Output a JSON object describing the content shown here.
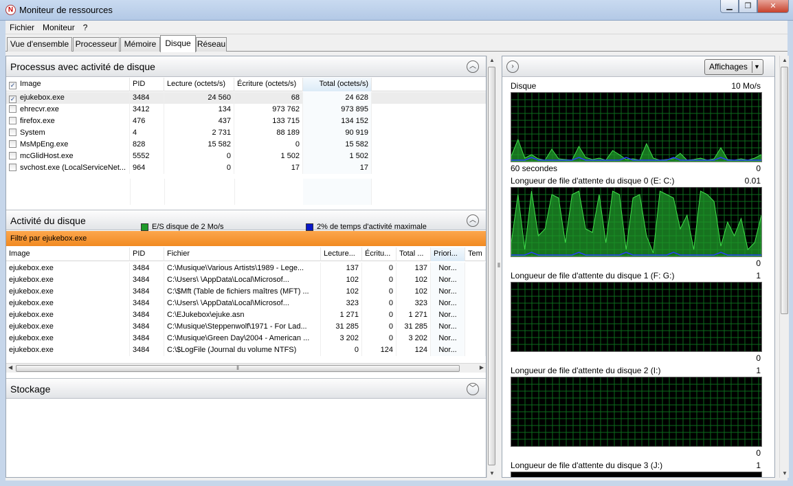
{
  "window": {
    "title": "Moniteur de ressources"
  },
  "menu": [
    "Fichier",
    "Moniteur",
    "?"
  ],
  "tabs": [
    "Vue d'ensemble",
    "Processeur",
    "Mémoire",
    "Disque",
    "Réseau"
  ],
  "active_tab": "Disque",
  "processes_section": {
    "title": "Processus avec activité de disque",
    "columns": [
      "Image",
      "PID",
      "Lecture (octets/s)",
      "Écriture (octets/s)",
      "Total (octets/s)"
    ],
    "rows": [
      {
        "image": "ejukebox.exe",
        "pid": "3484",
        "read": "24 560",
        "write": "68",
        "total": "24 628",
        "checked": true
      },
      {
        "image": "ehrecvr.exe",
        "pid": "3412",
        "read": "134",
        "write": "973 762",
        "total": "973 895",
        "checked": false
      },
      {
        "image": "firefox.exe",
        "pid": "476",
        "read": "437",
        "write": "133 715",
        "total": "134 152",
        "checked": false
      },
      {
        "image": "System",
        "pid": "4",
        "read": "2 731",
        "write": "88 189",
        "total": "90 919",
        "checked": false
      },
      {
        "image": "MsMpEng.exe",
        "pid": "828",
        "read": "15 582",
        "write": "0",
        "total": "15 582",
        "checked": false
      },
      {
        "image": "mcGlidHost.exe",
        "pid": "5552",
        "read": "0",
        "write": "1 502",
        "total": "1 502",
        "checked": false
      },
      {
        "image": "svchost.exe (LocalServiceNet...",
        "pid": "964",
        "read": "0",
        "write": "17",
        "total": "17",
        "checked": false
      }
    ]
  },
  "activity_section": {
    "title": "Activité du disque",
    "legend_io": "E/S disque de 2 Mo/s",
    "legend_io_color": "#1f9a2a",
    "legend_busy": "2% de temps d'activité maximale",
    "legend_busy_color": "#0a18c8",
    "filter": "Filtré par ejukebox.exe",
    "columns": [
      "Image",
      "PID",
      "Fichier",
      "Lecture...",
      "Écritu...",
      "Total ...",
      "Priori...",
      "Tem"
    ],
    "rows": [
      {
        "image": "ejukebox.exe",
        "pid": "3484",
        "file": "C:\\Musique\\Various Artists\\1989 - Lege...",
        "read": "137",
        "write": "0",
        "total": "137",
        "prio": "Nor..."
      },
      {
        "image": "ejukebox.exe",
        "pid": "3484",
        "file": "C:\\Users\\          \\AppData\\Local\\Microsof...",
        "read": "102",
        "write": "0",
        "total": "102",
        "prio": "Nor..."
      },
      {
        "image": "ejukebox.exe",
        "pid": "3484",
        "file": "C:\\$Mft (Table de fichiers maîtres (MFT) ...",
        "read": "102",
        "write": "0",
        "total": "102",
        "prio": "Nor..."
      },
      {
        "image": "ejukebox.exe",
        "pid": "3484",
        "file": "C:\\Users\\          \\AppData\\Local\\Microsof...",
        "read": "323",
        "write": "0",
        "total": "323",
        "prio": "Nor..."
      },
      {
        "image": "ejukebox.exe",
        "pid": "3484",
        "file": "C:\\EJukebox\\ejuke.asn",
        "read": "1 271",
        "write": "0",
        "total": "1 271",
        "prio": "Nor..."
      },
      {
        "image": "ejukebox.exe",
        "pid": "3484",
        "file": "C:\\Musique\\Steppenwolf\\1971 - For Lad...",
        "read": "31 285",
        "write": "0",
        "total": "31 285",
        "prio": "Nor..."
      },
      {
        "image": "ejukebox.exe",
        "pid": "3484",
        "file": "C:\\Musique\\Green Day\\2004 - American ...",
        "read": "3 202",
        "write": "0",
        "total": "3 202",
        "prio": "Nor..."
      },
      {
        "image": "ejukebox.exe",
        "pid": "3484",
        "file": "C:\\$LogFile (Journal du volume NTFS)",
        "read": "0",
        "write": "124",
        "total": "124",
        "prio": "Nor..."
      }
    ]
  },
  "storage_section": {
    "title": "Stockage"
  },
  "right_panel": {
    "views_button": "Affichages",
    "graphs": [
      {
        "label": "Disque",
        "max": "10 Mo/s",
        "under_left": "60 secondes",
        "min": "0"
      },
      {
        "label": "Longueur de file d'attente du disque 0 (E: C:)",
        "max": "0.01",
        "min": "0"
      },
      {
        "label": "Longueur de file d'attente du disque 1 (F: G:)",
        "max": "1",
        "min": "0"
      },
      {
        "label": "Longueur de file d'attente du disque 2 (I:)",
        "max": "1",
        "min": "0"
      },
      {
        "label": "Longueur de file d'attente du disque 3 (J:)",
        "max": "1",
        "min": ""
      }
    ]
  }
}
